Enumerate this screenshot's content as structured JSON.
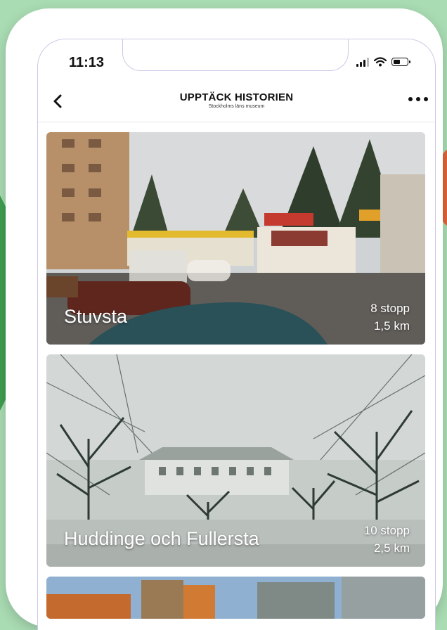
{
  "status_bar": {
    "time": "11:13"
  },
  "header": {
    "title": "UPPTÄCK HISTORIEN",
    "subtitle": "Stockholms läns museum"
  },
  "tours": [
    {
      "name": "Stuvsta",
      "stops": "8 stopp",
      "distance": "1,5 km"
    },
    {
      "name": "Huddinge och Fullersta",
      "stops": "10 stopp",
      "distance": "2,5 km"
    }
  ],
  "colors": {
    "background": "#a9dcb3",
    "arrow_green": "#3f9e4f",
    "accent_orange": "#e0643a"
  },
  "icons": [
    "back-chevron-icon",
    "more-dots-icon",
    "signal-icon",
    "wifi-icon",
    "battery-icon"
  ]
}
